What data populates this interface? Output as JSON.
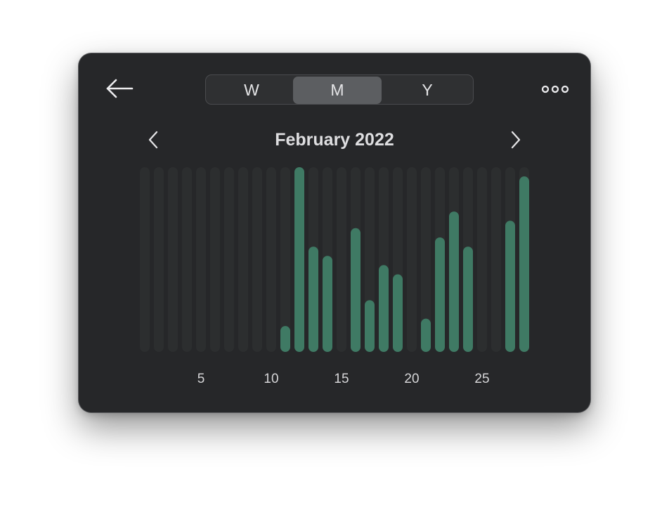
{
  "toolbar": {
    "back_icon": "arrow-left-icon",
    "more_icon": "more-horizontal-icon",
    "segments": [
      {
        "label": "W",
        "selected": false
      },
      {
        "label": "M",
        "selected": true
      },
      {
        "label": "Y",
        "selected": false
      }
    ]
  },
  "navigation": {
    "prev_icon": "chevron-left-icon",
    "next_icon": "chevron-right-icon",
    "title": "February 2022"
  },
  "colors": {
    "background": "#262729",
    "bar_fill": "#3f7a64",
    "bar_track": "#2c2e2f",
    "text": "#e4e4e6",
    "tick_text": "#d6d6d8"
  },
  "chart_data": {
    "type": "bar",
    "x": [
      1,
      2,
      3,
      4,
      5,
      6,
      7,
      8,
      9,
      10,
      11,
      12,
      13,
      14,
      15,
      16,
      17,
      18,
      19,
      20,
      21,
      22,
      23,
      24,
      25,
      26,
      27,
      28
    ],
    "values": [
      0,
      0,
      0,
      0,
      0,
      0,
      0,
      0,
      0,
      0,
      0.14,
      1.0,
      0.57,
      0.52,
      0,
      0.67,
      0.28,
      0.47,
      0.42,
      0,
      0.18,
      0.62,
      0.76,
      0.57,
      0,
      0,
      0.71,
      0.95
    ],
    "x_ticks": [
      "5",
      "10",
      "15",
      "20",
      "25"
    ],
    "tick_days": [
      5,
      10,
      15,
      20,
      25
    ],
    "ylim": [
      0,
      1
    ],
    "title": "",
    "xlabel": "",
    "ylabel": ""
  }
}
